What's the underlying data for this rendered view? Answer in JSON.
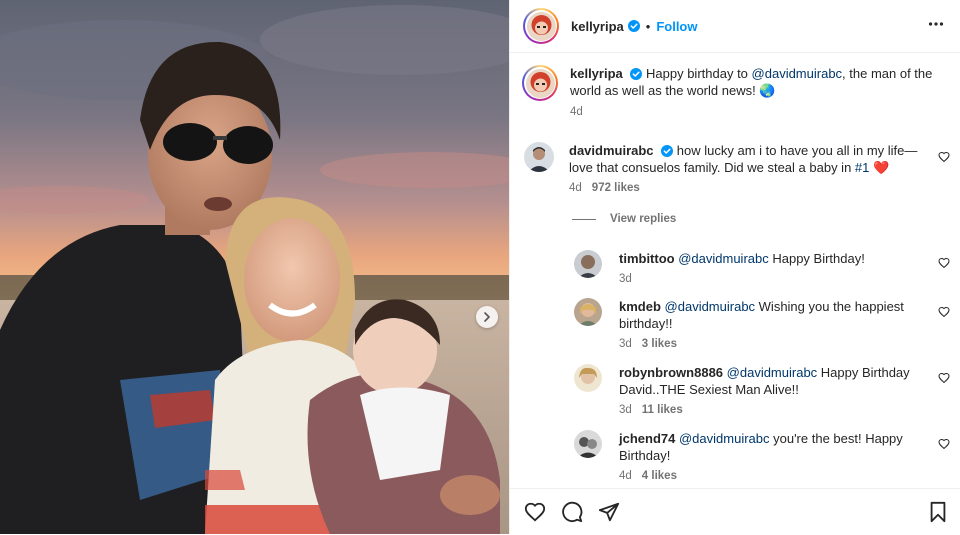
{
  "post": {
    "author": "kellyripa",
    "follow_label": "Follow",
    "separator": "•",
    "caption_parts": [
      "Happy birthday to ",
      "@davidmuirabc",
      ", the man of the world as well as the world news! 🌏"
    ],
    "caption_time": "4d"
  },
  "comments": [
    {
      "user": "davidmuirabc",
      "verified": true,
      "parts": [
        "how lucky am i to have you all in my life— love that consuelos family. Did we steal a baby in ",
        "#1",
        " ❤️"
      ],
      "time": "4d",
      "likes": "972 likes",
      "view_replies": "View replies"
    }
  ],
  "replies": [
    {
      "user": "timbittoo",
      "mention": "@davidmuirabc",
      "text": " Happy Birthday!",
      "time": "3d",
      "likes": ""
    },
    {
      "user": "kmdeb",
      "mention": "@davidmuirabc",
      "text": " Wishing you the happiest birthday!!",
      "time": "3d",
      "likes": "3 likes"
    },
    {
      "user": "robynbrown8886",
      "mention": "@davidmuirabc",
      "text": " Happy Birthday David..THE Sexiest Man Alive!!",
      "time": "3d",
      "likes": "11 likes"
    },
    {
      "user": "jchend74",
      "mention": "@davidmuirabc",
      "text": " you're the best! Happy Birthday!",
      "time": "4d",
      "likes": "4 likes"
    }
  ],
  "icons": [
    "verified-badge-icon",
    "more-options-icon",
    "heart-icon",
    "comment-icon",
    "share-icon",
    "bookmark-icon",
    "chevron-right-icon"
  ],
  "colors": {
    "link": "#0095f6",
    "mention": "#00376b",
    "muted": "#737373",
    "like_red": "#ed4956"
  }
}
